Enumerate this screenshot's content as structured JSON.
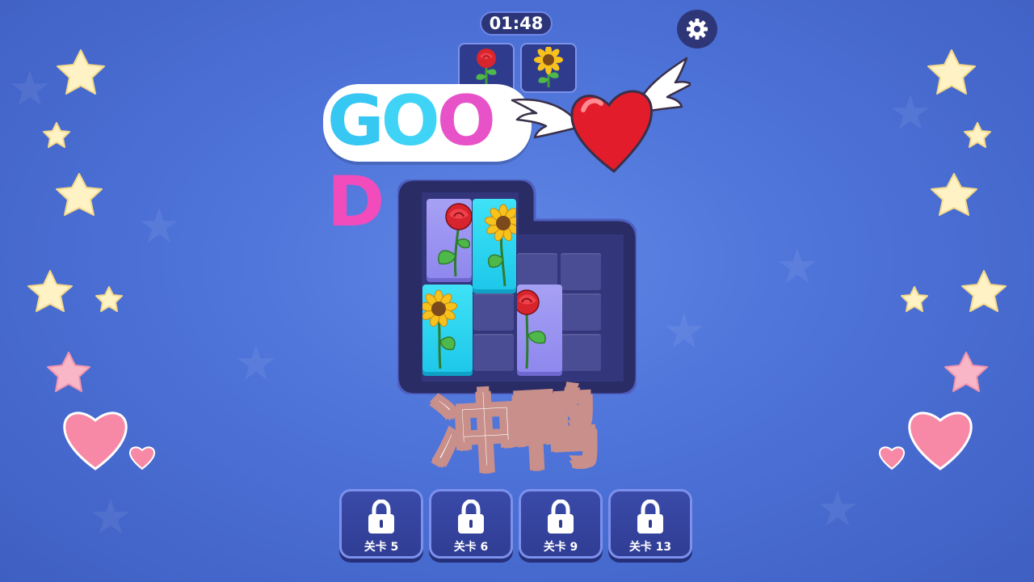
{
  "timer": {
    "value": "01:48"
  },
  "targets": [
    {
      "icon": "rose-icon"
    },
    {
      "icon": "sunflower-icon"
    }
  ],
  "feedback": {
    "good_letters": [
      "G",
      "O",
      "O",
      "D"
    ],
    "icon": "winged-heart-icon"
  },
  "slogan": {
    "text": "冲鸭"
  },
  "levels": [
    {
      "label": "关卡 5",
      "locked": true
    },
    {
      "label": "关卡 6",
      "locked": true
    },
    {
      "label": "关卡 9",
      "locked": true
    },
    {
      "label": "关卡 13",
      "locked": true
    }
  ],
  "colors": {
    "background": "#4d72d8",
    "board": "#2d2f6e",
    "purple_block": "#9a94f2",
    "cyan_block": "#2fd6f2"
  }
}
